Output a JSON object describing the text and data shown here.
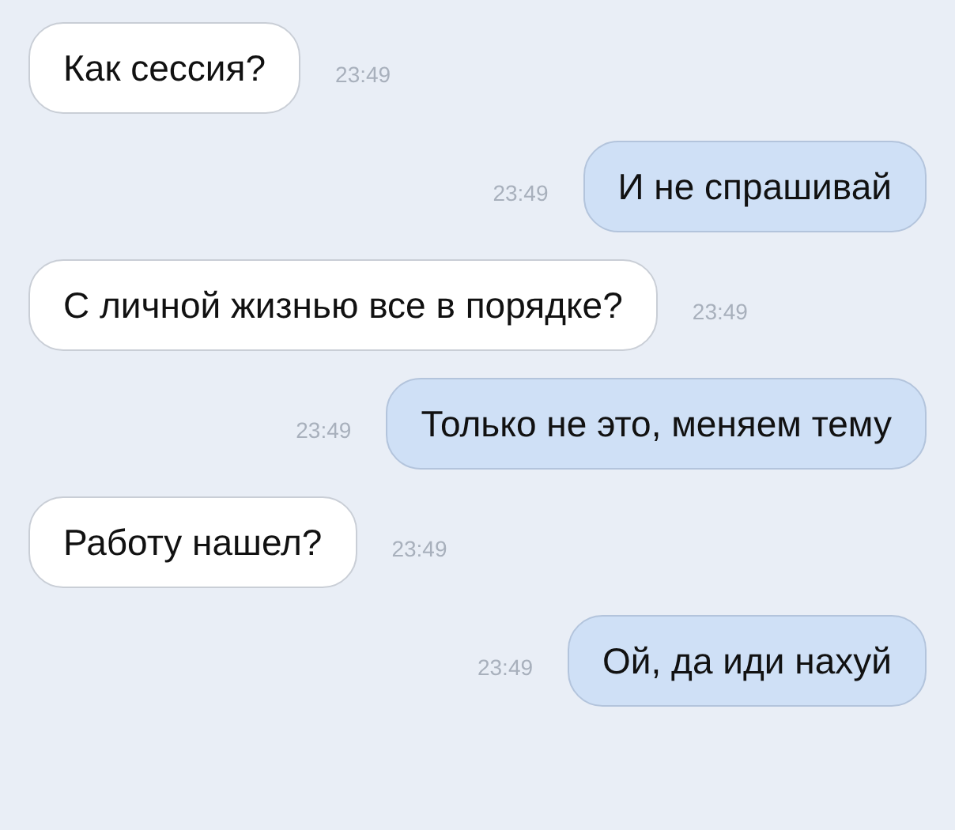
{
  "messages": [
    {
      "kind": "incoming",
      "text": "Как сессия?",
      "time": "23:49"
    },
    {
      "kind": "outgoing",
      "text": "И не спрашивай",
      "time": "23:49"
    },
    {
      "kind": "incoming",
      "text": "С личной жизнью все в порядке?",
      "time": "23:49"
    },
    {
      "kind": "outgoing",
      "text": "Только не это, меняем тему",
      "time": "23:49"
    },
    {
      "kind": "incoming",
      "text": "Работу нашел?",
      "time": "23:49"
    },
    {
      "kind": "outgoing",
      "text": "Ой, да иди нахуй",
      "time": "23:49"
    }
  ]
}
